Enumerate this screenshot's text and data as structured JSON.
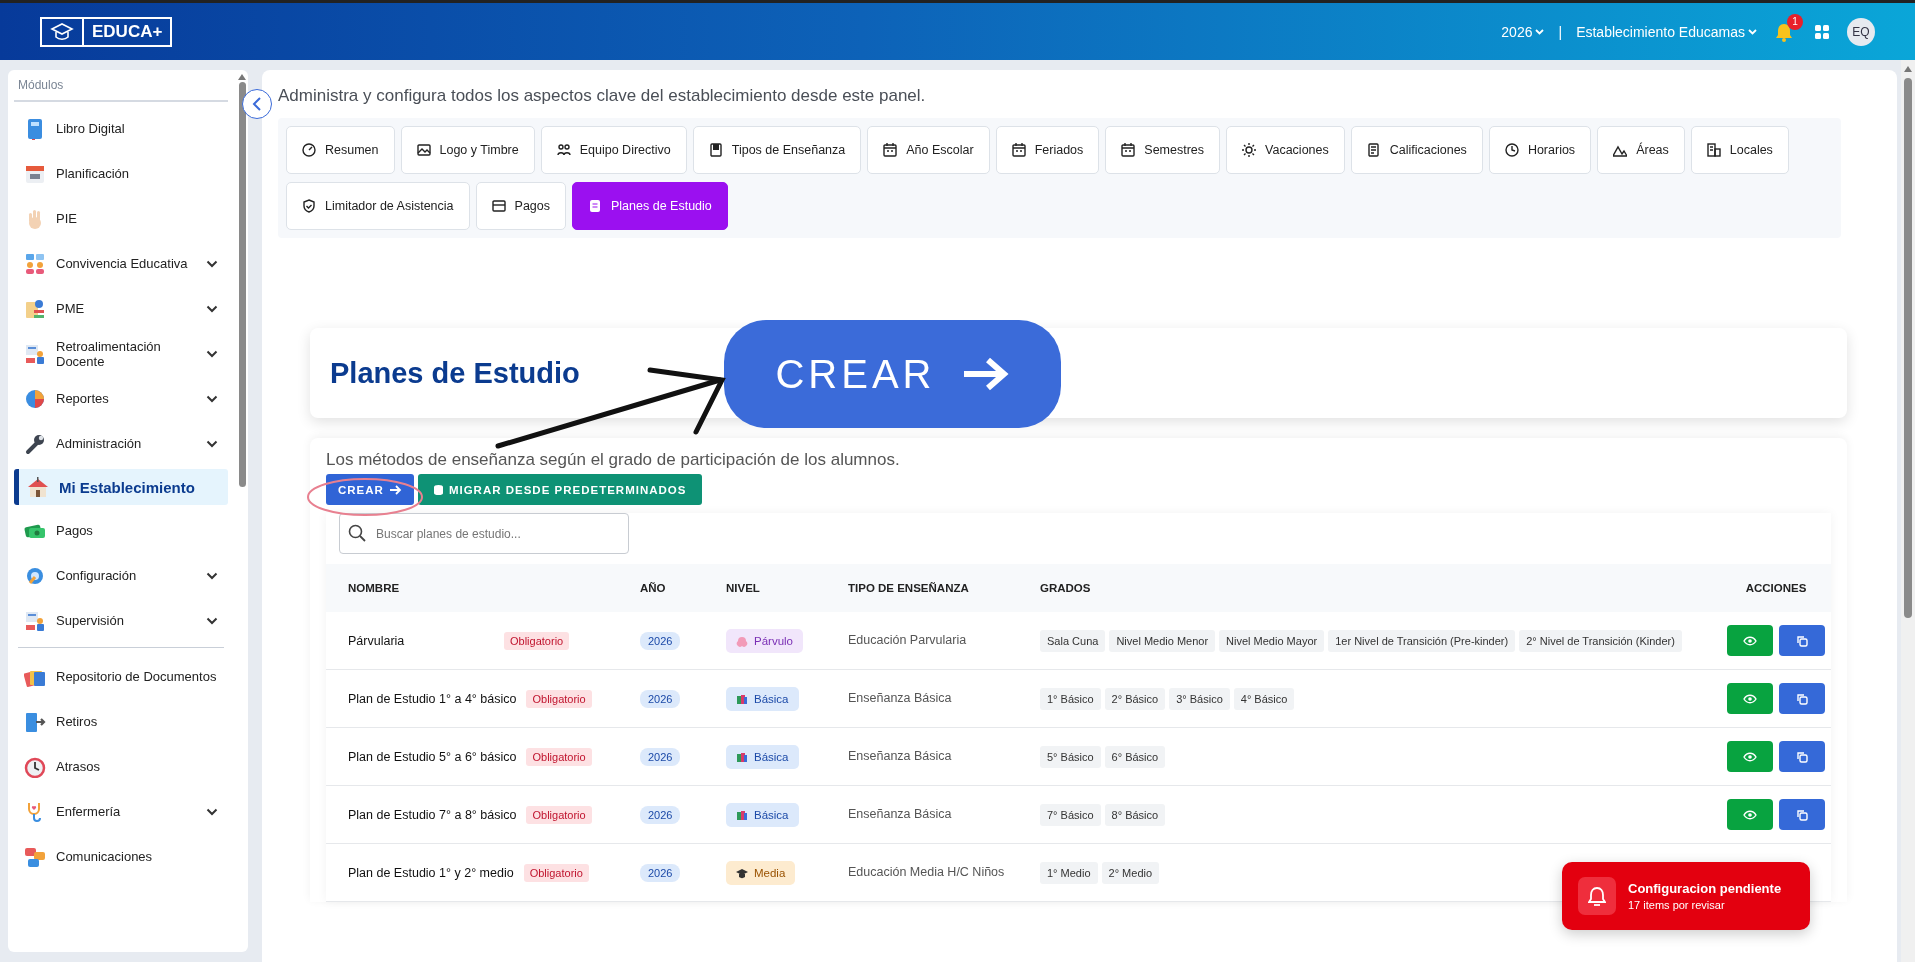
{
  "topbar": {
    "logo": "EDUCA+",
    "year": "2026",
    "separator": "|",
    "establishment": "Establecimiento Educamas",
    "notifications": "1",
    "avatar": "EQ"
  },
  "sidebar": {
    "heading": "Módulos",
    "sections": [
      {
        "items": [
          {
            "label": "Libro Digital",
            "expandable": false,
            "selected": false
          },
          {
            "label": "Planificación",
            "expandable": false,
            "selected": false
          },
          {
            "label": "PIE",
            "expandable": false,
            "selected": false
          },
          {
            "label": "Convivencia Educativa",
            "expandable": true,
            "selected": false
          },
          {
            "label": "PME",
            "expandable": true,
            "selected": false
          },
          {
            "label": "Retroalimentación Docente",
            "expandable": true,
            "selected": false
          },
          {
            "label": "Reportes",
            "expandable": true,
            "selected": false
          },
          {
            "label": "Administración",
            "expandable": true,
            "selected": false
          },
          {
            "label": "Mi Establecimiento",
            "expandable": false,
            "selected": true
          },
          {
            "label": "Pagos",
            "expandable": false,
            "selected": false
          },
          {
            "label": "Configuración",
            "expandable": true,
            "selected": false
          },
          {
            "label": "Supervisión",
            "expandable": true,
            "selected": false
          }
        ]
      },
      {
        "items": [
          {
            "label": "Repositorio de Documentos",
            "expandable": false,
            "selected": false
          },
          {
            "label": "Retiros",
            "expandable": false,
            "selected": false
          },
          {
            "label": "Atrasos",
            "expandable": false,
            "selected": false
          },
          {
            "label": "Enfermería",
            "expandable": true,
            "selected": false
          },
          {
            "label": "Comunicaciones",
            "expandable": false,
            "selected": false
          }
        ]
      }
    ]
  },
  "intro": "Administra y configura todos los aspectos clave del establecimiento desde este panel.",
  "tabs": [
    {
      "label": "Resumen",
      "selected": false
    },
    {
      "label": "Logo y Timbre",
      "selected": false
    },
    {
      "label": "Equipo Directivo",
      "selected": false
    },
    {
      "label": "Tipos de Enseñanza",
      "selected": false
    },
    {
      "label": "Año Escolar",
      "selected": false
    },
    {
      "label": "Feriados",
      "selected": false
    },
    {
      "label": "Semestres",
      "selected": false
    },
    {
      "label": "Vacaciones",
      "selected": false
    },
    {
      "label": "Calificaciones",
      "selected": false
    },
    {
      "label": "Horarios",
      "selected": false
    },
    {
      "label": "Áreas",
      "selected": false
    },
    {
      "label": "Locales",
      "selected": false
    },
    {
      "label": "Limitador de Asistencia",
      "selected": false
    },
    {
      "label": "Pagos",
      "selected": false
    },
    {
      "label": "Planes de Estudio",
      "selected": true
    }
  ],
  "header": {
    "title": "Planes de Estudio"
  },
  "callout": {
    "label": "CREAR"
  },
  "plans": {
    "description": "Los métodos de enseñanza según el grado de participación de los alumnos.",
    "create_button": "CREAR",
    "migrate_button": "MIGRAR DESDE PREDETERMINADOS",
    "search": {
      "placeholder": "Buscar planes de estudio..."
    },
    "columns": [
      "NOMBRE",
      "AÑO",
      "NIVEL",
      "TIPO DE ENSEÑANZA",
      "GRADOS",
      "ACCIONES"
    ],
    "rows": [
      {
        "name": "Párvularia",
        "tag": "Obligatorio",
        "year": "2026",
        "level": {
          "label": "Párvulo",
          "kind": "parvulo"
        },
        "type": "Educación Parvularia",
        "grades": [
          "Sala Cuna",
          "Nivel Medio Menor",
          "Nivel Medio Mayor",
          "1er Nivel de Transición (Pre-kinder)",
          "2° Nivel de Transición (Kinder)"
        ],
        "actions": true
      },
      {
        "name": "Plan de Estudio 1° a 4° básico",
        "tag": "Obligatorio",
        "year": "2026",
        "level": {
          "label": "Básica",
          "kind": "basica"
        },
        "type": "Enseñanza Básica",
        "grades": [
          "1° Básico",
          "2° Básico",
          "3° Básico",
          "4° Básico"
        ],
        "actions": true
      },
      {
        "name": "Plan de Estudio 5° a 6° básico",
        "tag": "Obligatorio",
        "year": "2026",
        "level": {
          "label": "Básica",
          "kind": "basica"
        },
        "type": "Enseñanza Básica",
        "grades": [
          "5° Básico",
          "6° Básico"
        ],
        "actions": true
      },
      {
        "name": "Plan de Estudio 7° a 8° básico",
        "tag": "Obligatorio",
        "year": "2026",
        "level": {
          "label": "Básica",
          "kind": "basica"
        },
        "type": "Enseñanza Básica",
        "grades": [
          "7° Básico",
          "8° Básico"
        ],
        "actions": true
      },
      {
        "name": "Plan de Estudio 1° y 2° medio",
        "tag": "Obligatorio",
        "year": "2026",
        "level": {
          "label": "Media",
          "kind": "media"
        },
        "type": "Educación Media H/C Niños",
        "grades": [
          "1° Medio",
          "2° Medio"
        ],
        "actions": false
      }
    ]
  },
  "toast": {
    "title": "Configuracion pendiente",
    "subtitle": "17 items por revisar"
  }
}
